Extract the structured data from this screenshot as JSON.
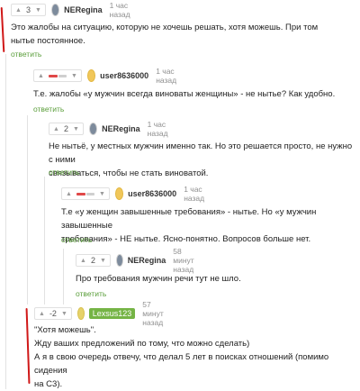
{
  "comments": [
    {
      "rating": "3",
      "user": "NERegina",
      "time": "1 час назад",
      "text_lines": [
        "Это жалобы на ситуацию, которую не хочешь решать, хотя можешь. При том",
        "нытье постоянное."
      ],
      "reply": "ответить"
    },
    {
      "rating": "",
      "user": "user8636000",
      "time": "1 час назад",
      "text_lines": [
        "Т.е. жалобы «у мужчин всегда виноваты женщины» - не нытье? Как удобно."
      ],
      "reply": "ответить"
    },
    {
      "rating": "2",
      "user": "NERegina",
      "time": "1 час назад",
      "text_lines": [
        "Не нытьё, у местных мужчин именно так. Но это решается просто, не нужно с ними",
        "связываться, чтобы не стать виноватой."
      ],
      "reply": "ответить"
    },
    {
      "rating": "",
      "user": "user8636000",
      "time": "1 час назад",
      "text_lines": [
        "Т.е «у женщин завышенные требования» - нытье. Но «у мужчин завышенные",
        "требования» - НЕ нытье. Ясно-понятно. Вопросов больше нет."
      ],
      "reply": "ответить"
    },
    {
      "rating": "2",
      "user": "NERegina",
      "time": "58 минут назад",
      "text_lines": [
        "Про требования мужчин речи тут не шло."
      ],
      "reply": "ответить"
    },
    {
      "rating": "-2",
      "user": "Lexsus123",
      "time": "57 минут назад",
      "text_lines": [
        "\"Хотя можешь\".",
        "Жду ваших предложений по тому, что можно сделать)",
        "А я в свою очередь отвечу, что делал 5 лет в поисках отношений (помимо сидения",
        "на С3)."
      ],
      "reply": ""
    }
  ],
  "colors": {
    "reply_link": "#5a9e3a",
    "username_tag_bg": "#75b445",
    "annotation_red": "#d01818",
    "rating_negative": "#e04848"
  },
  "icons": {
    "up": "triangle-up",
    "down": "triangle-down"
  }
}
